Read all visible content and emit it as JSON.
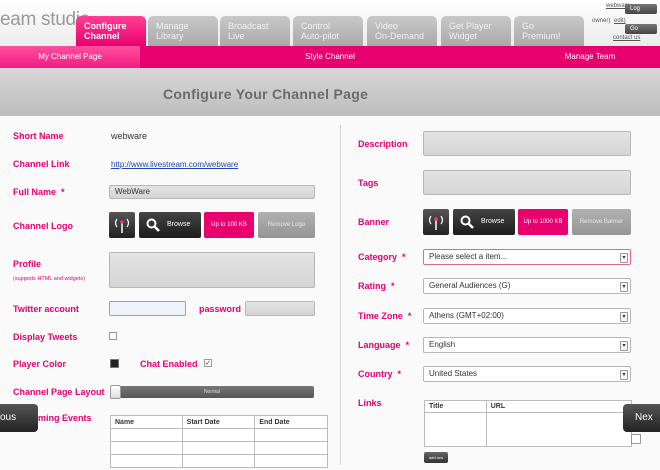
{
  "brand": {
    "logo_text": "eam studio"
  },
  "tabs": [
    {
      "l1": "Configure",
      "l2": "Channel"
    },
    {
      "l1": "Manage",
      "l2": "Library"
    },
    {
      "l1": "Broadcast",
      "l2": "Live"
    },
    {
      "l1": "Control",
      "l2": "Auto-pilot"
    },
    {
      "l1": "Video",
      "l2": "On-Demand"
    },
    {
      "l1": "Get Player",
      "l2": "Widget"
    },
    {
      "l1": "Go",
      "l2": "Premium!"
    }
  ],
  "top_right": {
    "link1": "webware",
    "owner_label": "owner)",
    "link2": "edit)",
    "link3": "contact us",
    "btn1": "Log",
    "btn2": "Go"
  },
  "subnav": {
    "items": [
      "My Channel Page",
      "Style Channel",
      "Manage Team"
    ]
  },
  "page_title": "Configure Your Channel Page",
  "form_left": {
    "short_name_label": "Short Name",
    "short_name_value": "webware",
    "channel_link_label": "Channel Link",
    "channel_link_value": "http://www.livestream.com/webware",
    "full_name_label": "Full Name",
    "full_name_value": "WebWare",
    "required_mark": "*",
    "channel_logo_label": "Channel Logo",
    "browse_label": "Browse",
    "size_limit": "Up to 100 KB",
    "remove_logo": "Remove Logo",
    "profile_label": "Profile",
    "profile_sub": "(supports HTML and widgets)",
    "twitter_label": "Twitter account",
    "password_label": "password",
    "display_tweets_label": "Display Tweets",
    "player_color_label": "Player Color",
    "chat_enabled_label": "Chat Enabled",
    "chat_check": "✓",
    "layout_label": "Channel Page Layout",
    "layout_value": "Normal",
    "events_label": "ming Events",
    "events_headers": [
      "Name",
      "Start Date",
      "End Date"
    ]
  },
  "form_right": {
    "description_label": "Description",
    "tags_label": "Tags",
    "banner_label": "Banner",
    "browse_label": "Browse",
    "size_limit": "Up to 1000 KB",
    "remove_banner": "Remove Banner",
    "category_label": "Category",
    "category_value": "Please select a item...",
    "rating_label": "Rating",
    "rating_value": "General Audiences (G)",
    "timezone_label": "Time Zone",
    "timezone_value": "Athens (GMT+02:00)",
    "language_label": "Language",
    "language_value": "English",
    "country_label": "Country",
    "country_value": "United States",
    "links_label": "Links",
    "links_headers": [
      "Title",
      "URL"
    ],
    "add_row": "add row"
  },
  "nav": {
    "prev": "ous",
    "next": "Nex"
  },
  "colors": {
    "accent": "#e8006e"
  }
}
